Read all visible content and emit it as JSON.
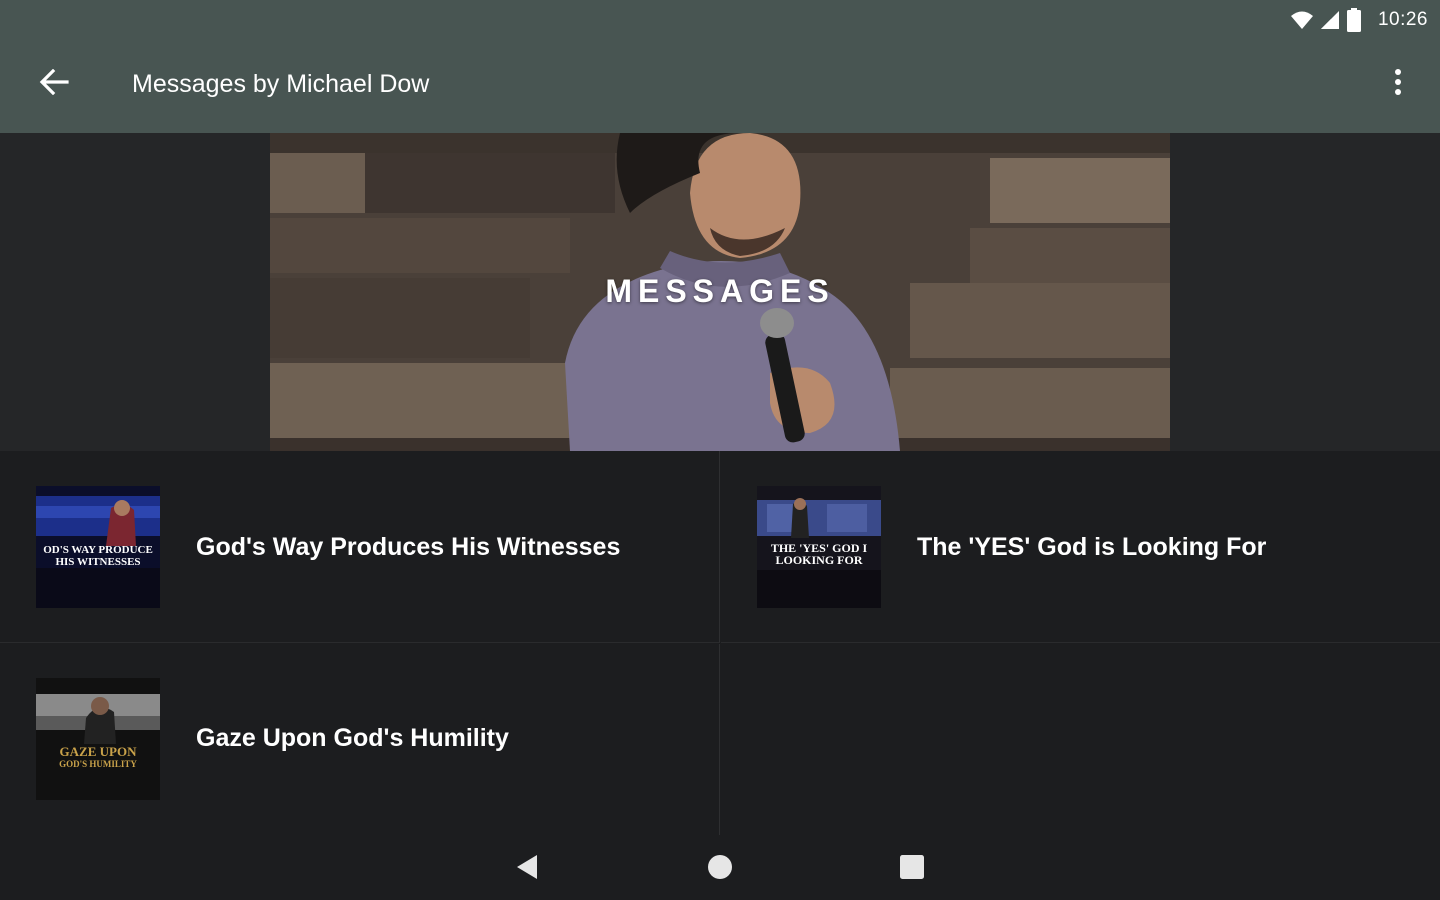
{
  "status_bar": {
    "time": "10:26",
    "icons": [
      "wifi-icon",
      "cell-signal-icon",
      "battery-icon"
    ]
  },
  "app_bar": {
    "title": "Messages by Michael Dow",
    "back_icon": "arrow-left-icon",
    "menu_icon": "more-vert-icon"
  },
  "hero": {
    "text": "MESSAGES"
  },
  "messages": [
    {
      "title": "God's Way Produces His Witnesses",
      "thumb_lines": [
        "OD'S WAY PRODUCE",
        "HIS WITNESSES"
      ]
    },
    {
      "title": "The 'YES' God is Looking For",
      "thumb_lines": [
        "THE 'YES' GOD I",
        "LOOKING FOR"
      ]
    },
    {
      "title": "Gaze Upon God's Humility",
      "thumb_lines": [
        "GAZE UPON",
        "GOD'S HUMILITY"
      ]
    }
  ],
  "nav": {
    "back_icon": "nav-back-icon",
    "home_icon": "nav-home-icon",
    "recents_icon": "nav-recents-icon"
  },
  "colors": {
    "app_bar": "#485552",
    "background": "#1c1d1f",
    "hero_side": "#252628",
    "divider": "#2e2f31"
  }
}
